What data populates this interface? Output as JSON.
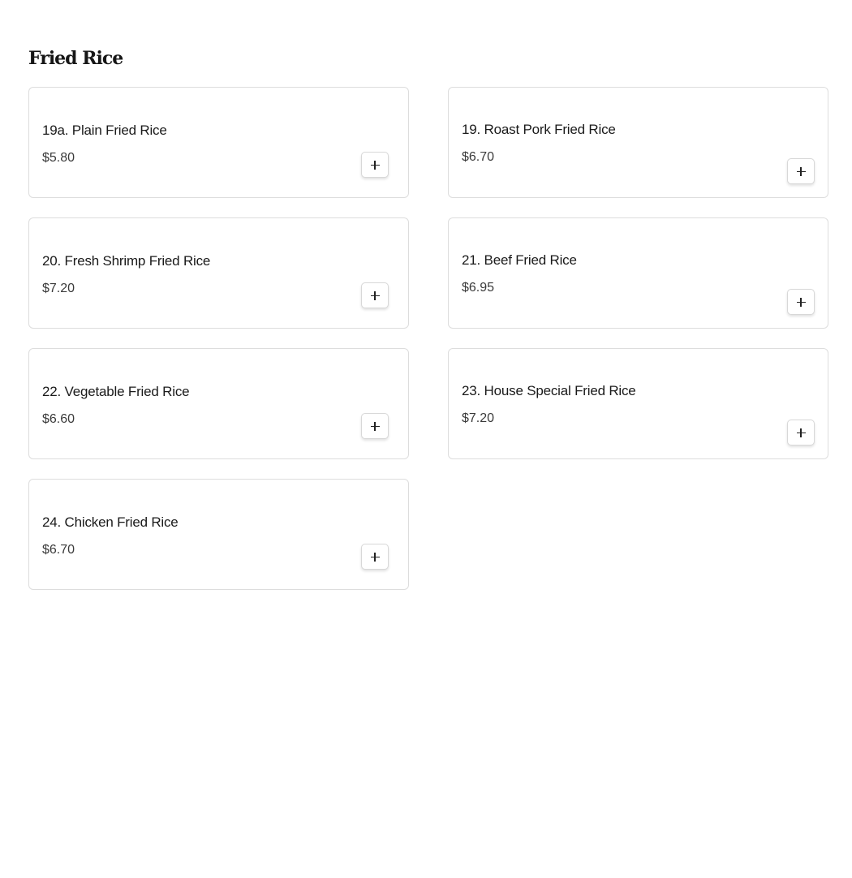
{
  "section": {
    "title": "Fried Rice"
  },
  "items": [
    {
      "name": "19a. Plain Fried Rice",
      "price": "$5.80",
      "add_label": "+"
    },
    {
      "name": "19. Roast Pork Fried Rice",
      "price": "$6.70",
      "add_label": "+"
    },
    {
      "name": "20. Fresh Shrimp Fried Rice",
      "price": "$7.20",
      "add_label": "+"
    },
    {
      "name": "21. Beef Fried Rice",
      "price": "$6.95",
      "add_label": "+"
    },
    {
      "name": "22. Vegetable Fried Rice",
      "price": "$6.60",
      "add_label": "+"
    },
    {
      "name": "23. House Special Fried Rice",
      "price": "$7.20",
      "add_label": "+"
    },
    {
      "name": "24. Chicken Fried Rice",
      "price": "$6.70",
      "add_label": "+"
    }
  ],
  "icons": {
    "add": "plus-icon"
  }
}
